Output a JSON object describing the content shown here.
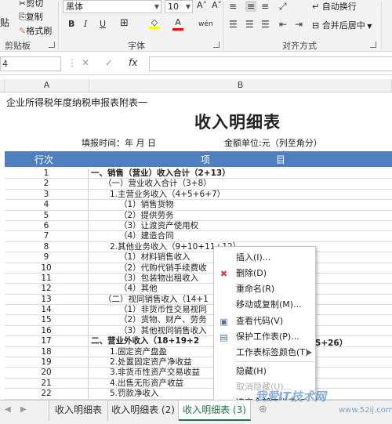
{
  "ribbon": {
    "clipboard": {
      "paste": "贴",
      "cut": "剪切",
      "copy": "复制",
      "format_painter": "格式刷",
      "label": "剪贴板"
    },
    "font": {
      "name": "黑体",
      "size": "10",
      "grow": "A˄",
      "shrink": "A˅",
      "bold": "B",
      "italic": "I",
      "underline": "U",
      "border": "⊞",
      "fill_color": "A",
      "font_color": "A",
      "phonetic": "wén",
      "label": "字体"
    },
    "alignment": {
      "wrap": "自动换行",
      "merge": "合并后居中",
      "label": "对齐方式"
    },
    "colors": {
      "fill": "#ffff00",
      "font": "#ff0000",
      "accent": "#217346"
    }
  },
  "formula_bar": {
    "name_box": "4",
    "cancel": "✕",
    "enter": "✓",
    "fx": "fx"
  },
  "columns": {
    "a": "A",
    "b": "B"
  },
  "sheet": {
    "subtitle": "企业所得税年度纳税申报表附表一",
    "title": "收入明细表",
    "fill_time": "填报时间：年  月  日",
    "unit": "金额单位:元（列至角分）",
    "headers": {
      "row_no": "行次",
      "item": "项　　　　　　　目"
    },
    "header_color": "#4f7fbd",
    "rows": [
      {
        "n": "1",
        "t": "一、销售（营业）收入合计（2+13）",
        "b": true
      },
      {
        "n": "2",
        "t": "（一）营业收入合计（3+8）",
        "b": false
      },
      {
        "n": "3",
        "t": "1.主营业务收入（4+5+6+7）",
        "b": false
      },
      {
        "n": "4",
        "t": "（1）销售货物",
        "b": false
      },
      {
        "n": "5",
        "t": "（2）提供劳务",
        "b": false
      },
      {
        "n": "6",
        "t": "（3）让渡资产使用权",
        "b": false
      },
      {
        "n": "7",
        "t": "（4）建造合同",
        "b": false
      },
      {
        "n": "8",
        "t": "2.其他业务收入（9+10+11+12）",
        "b": false
      },
      {
        "n": "9",
        "t": "（1）材料销售收入",
        "b": false
      },
      {
        "n": "10",
        "t": "（2）代购代销手续费收",
        "b": false
      },
      {
        "n": "11",
        "t": "（3）包装物出租收入",
        "b": false
      },
      {
        "n": "12",
        "t": "（4）其他",
        "b": false
      },
      {
        "n": "13",
        "t": "（二）视同销售收入（14+1",
        "b": false
      },
      {
        "n": "14",
        "t": "（1）非货币性交易视同",
        "b": false
      },
      {
        "n": "15",
        "t": "（2）货物、财产、劳务",
        "b": false
      },
      {
        "n": "16",
        "t": "（3）其他视同销售收入",
        "b": false
      },
      {
        "n": "17",
        "t": "二、营业外收入（18+19+2",
        "b": true
      },
      {
        "n": "18",
        "t": "1.固定资产盘盈",
        "b": false
      },
      {
        "n": "19",
        "t": "2.处置固定资产净收益",
        "b": false
      },
      {
        "n": "20",
        "t": "3.非货币性资产交易收益",
        "b": false
      },
      {
        "n": "21",
        "t": "4.出售无形资产收益",
        "b": false
      },
      {
        "n": "22",
        "t": "5.罚款净收入",
        "b": false
      }
    ],
    "row17_tail": "5+26）"
  },
  "context_menu": {
    "items": [
      {
        "label": "插入(I)...",
        "icon": "",
        "disabled": false
      },
      {
        "label": "删除(D)",
        "icon": "delete-sheet-icon",
        "disabled": false
      },
      {
        "label": "重命名(R)",
        "icon": "",
        "disabled": false
      },
      {
        "label": "移动或复制(M)...",
        "icon": "",
        "disabled": false
      },
      {
        "label": "查看代码(V)",
        "icon": "view-code-icon",
        "disabled": false
      },
      {
        "label": "保护工作表(P)...",
        "icon": "protect-sheet-icon",
        "disabled": false
      },
      {
        "label": "工作表标签颜色(T)",
        "icon": "",
        "disabled": false
      },
      {
        "label": "隐藏(H)",
        "icon": "",
        "disabled": false
      },
      {
        "label": "取消隐藏(U)...",
        "icon": "",
        "disabled": true
      },
      {
        "label": "选定全部工作表(S)",
        "icon": "",
        "disabled": false
      }
    ]
  },
  "tabs": {
    "items": [
      "收入明细表",
      "收入明细表 (2)",
      "收入明细表 (3)"
    ],
    "active_index": 2,
    "add": "⊕"
  },
  "watermark": {
    "main": "我爱IT技术网",
    "sub": "www.52ij.com"
  }
}
